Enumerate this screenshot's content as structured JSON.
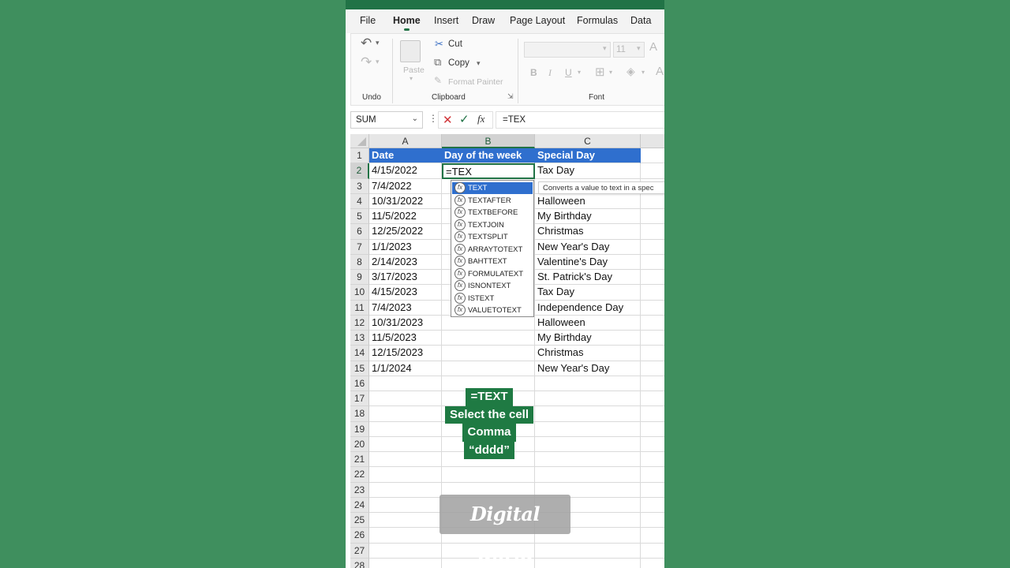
{
  "ribbon_tabs": [
    "File",
    "Home",
    "Insert",
    "Draw",
    "Page Layout",
    "Formulas",
    "Data"
  ],
  "active_tab": "Home",
  "ribbon": {
    "undo_label": "Undo",
    "clipboard_label": "Clipboard",
    "font_label": "Font",
    "paste_label": "Paste",
    "cut_label": "Cut",
    "copy_label": "Copy",
    "format_painter_label": "Format Painter",
    "font_size": "11",
    "bold": "B",
    "italic": "I",
    "underline": "U"
  },
  "formula_bar": {
    "name_box": "SUM",
    "formula": "=TEX",
    "fx": "fx"
  },
  "columns": [
    "A",
    "B",
    "C"
  ],
  "rows": [
    "1",
    "2",
    "3",
    "4",
    "5",
    "6",
    "7",
    "8",
    "9",
    "10",
    "11",
    "12",
    "13",
    "14",
    "15",
    "16",
    "17",
    "18",
    "19",
    "20",
    "21",
    "22",
    "23",
    "24",
    "25",
    "26",
    "27",
    "28"
  ],
  "header_row": [
    "Date",
    "Day of the week",
    "Special Day"
  ],
  "data_rows": [
    [
      "4/15/2022",
      "=TEX",
      "Tax Day"
    ],
    [
      "7/4/2022",
      "",
      ""
    ],
    [
      "10/31/2022",
      "",
      "Halloween"
    ],
    [
      "11/5/2022",
      "",
      "My Birthday"
    ],
    [
      "12/25/2022",
      "",
      "Christmas"
    ],
    [
      "1/1/2023",
      "",
      "New Year's Day"
    ],
    [
      "2/14/2023",
      "",
      "Valentine's Day"
    ],
    [
      "3/17/2023",
      "",
      "St. Patrick's Day"
    ],
    [
      "4/15/2023",
      "",
      "Tax Day"
    ],
    [
      "7/4/2023",
      "",
      "Independence Day"
    ],
    [
      "10/31/2023",
      "",
      "Halloween"
    ],
    [
      "11/5/2023",
      "",
      "My Birthday"
    ],
    [
      "12/15/2023",
      "",
      "Christmas"
    ],
    [
      "1/1/2024",
      "",
      "New Year's Day"
    ]
  ],
  "autocomplete": [
    "TEXT",
    "TEXTAFTER",
    "TEXTBEFORE",
    "TEXTJOIN",
    "TEXTSPLIT",
    "ARRAYTOTEXT",
    "BAHTTEXT",
    "FORMULATEXT",
    "ISNONTEXT",
    "ISTEXT",
    "VALUETOTEXT"
  ],
  "tooltip": "Converts a value to text in a spec",
  "overlay_note": [
    "=TEXT",
    "Select the cell",
    "Comma",
    "“dddd”"
  ],
  "watermark": "Digital world",
  "colors": {
    "excel_green": "#217346",
    "header_blue": "#2f6fce",
    "background": "#3f8f5e"
  }
}
